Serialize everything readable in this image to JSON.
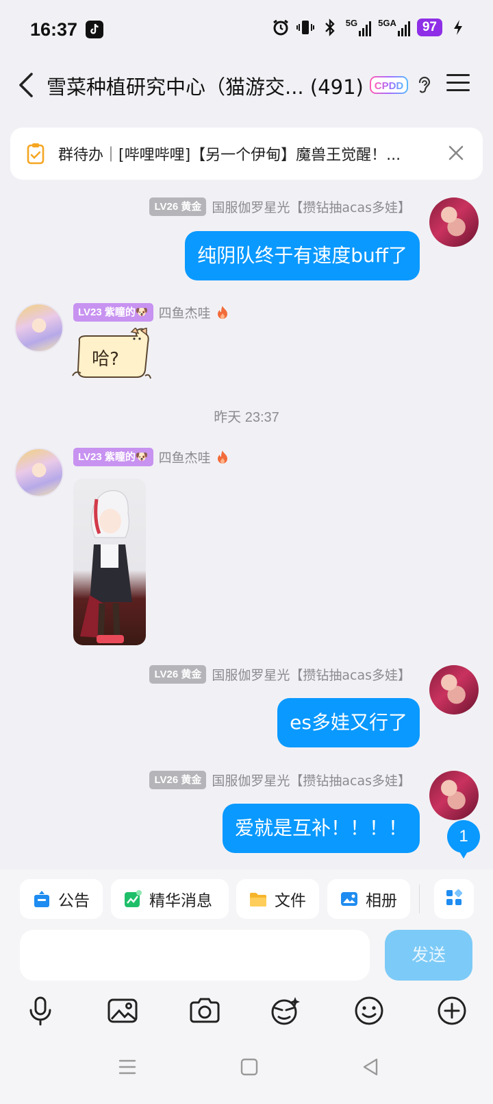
{
  "status_bar": {
    "time": "16:37",
    "net1": "5G",
    "net2": "5GA",
    "battery": "97"
  },
  "header": {
    "title": "雪菜种植研究中心（猫游交... (491)",
    "badge_text": "CPDD"
  },
  "todo": {
    "text": "群待办｜[哔哩哔哩]【另一个伊甸】魔兽王觉醒！..."
  },
  "messages": [
    {
      "side": "right",
      "level": "LV26 黄金",
      "nick": "国服伽罗星光【攒钻抽acas多娃】",
      "text": "纯阴队终于有速度buff了"
    },
    {
      "side": "left",
      "level": "LV23 紫瞳的🐶",
      "nick": "四鱼杰哇",
      "sticker_text": "哈?"
    },
    {
      "side": "left",
      "level": "LV23 紫瞳的🐶",
      "nick": "四鱼杰哇",
      "kind": "image"
    },
    {
      "side": "right",
      "level": "LV26 黄金",
      "nick": "国服伽罗星光【攒钻抽acas多娃】",
      "text": "es多娃又行了"
    },
    {
      "side": "right",
      "level": "LV26 黄金",
      "nick": "国服伽罗星光【攒钻抽acas多娃】",
      "text": "爱就是互补！！！！"
    }
  ],
  "timestamp": "昨天 23:37",
  "unread_count": "1",
  "tools": {
    "chips": [
      {
        "label": "公告",
        "icon": "announcement-icon"
      },
      {
        "label": "精华消息",
        "icon": "essence-icon"
      },
      {
        "label": "文件",
        "icon": "folder-icon"
      },
      {
        "label": "相册",
        "icon": "album-icon"
      }
    ],
    "more_icon": "apps-icon",
    "send_label": "发送"
  },
  "bottom_icons": [
    "mic-icon",
    "image-icon",
    "camera-icon",
    "sticker-icon",
    "emoji-icon",
    "plus-icon"
  ],
  "colors": {
    "bubble": "#0a99ff",
    "send_disabled": "#7ccaf7",
    "badge_gold": "#b4b4b9",
    "badge_purple": "#c792f0",
    "battery": "#8e2ee6"
  }
}
